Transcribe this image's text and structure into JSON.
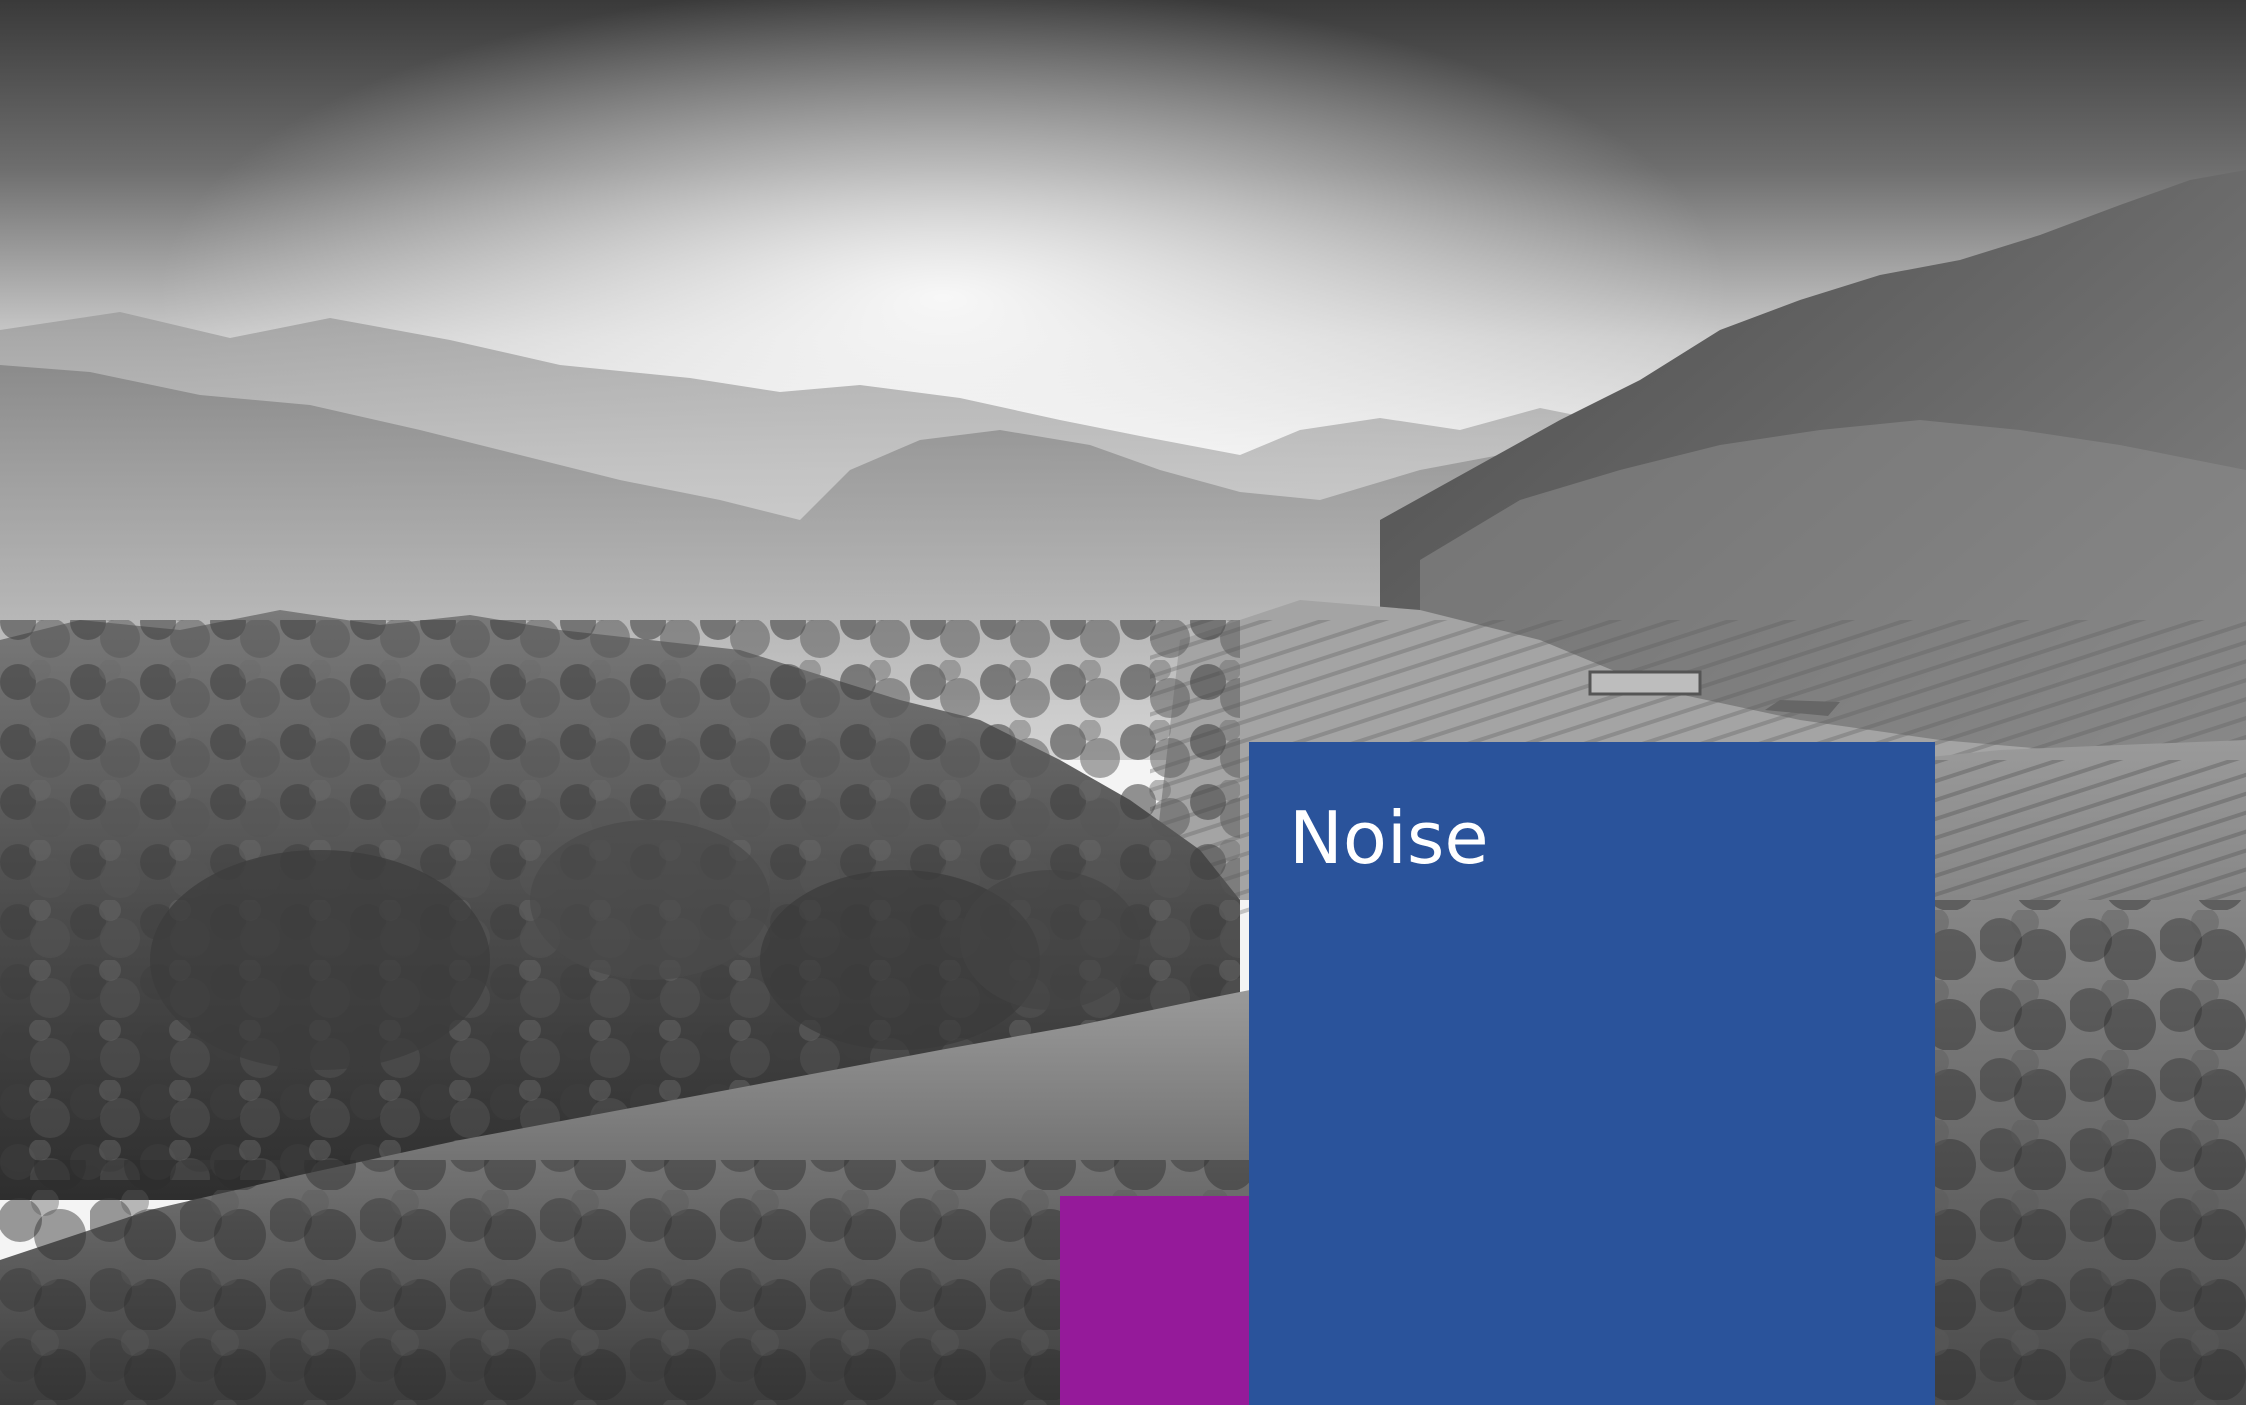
{
  "slide": {
    "title": "Noise"
  },
  "background": {
    "subject": "monochrome-mountain-valley-photo",
    "style": "grayscale"
  },
  "colors": {
    "panel": "#2a539b",
    "accent": "#951a9a",
    "title_text": "#ffffff"
  }
}
